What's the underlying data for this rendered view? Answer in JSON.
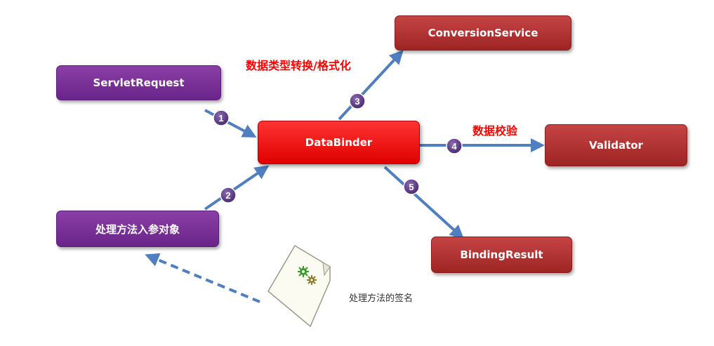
{
  "nodes": {
    "servlet_request": "ServletRequest",
    "handler_args": "处理方法入参对象",
    "data_binder": "DataBinder",
    "conversion_service": "ConversionService",
    "validator": "Validator",
    "binding_result": "BindingResult"
  },
  "labels": {
    "conversion": "数据类型转换/格式化",
    "validation": "数据校验",
    "signature": "处理方法的签名"
  },
  "steps": [
    "1",
    "2",
    "3",
    "4",
    "5"
  ],
  "colors": {
    "purple_box": "#7a3098",
    "dark_red_box": "#b03030",
    "bright_red_box": "#f00000",
    "arrow_blue": "#4f7fbf",
    "step_circle": "#5a3585",
    "label_red": "#ff0000"
  }
}
